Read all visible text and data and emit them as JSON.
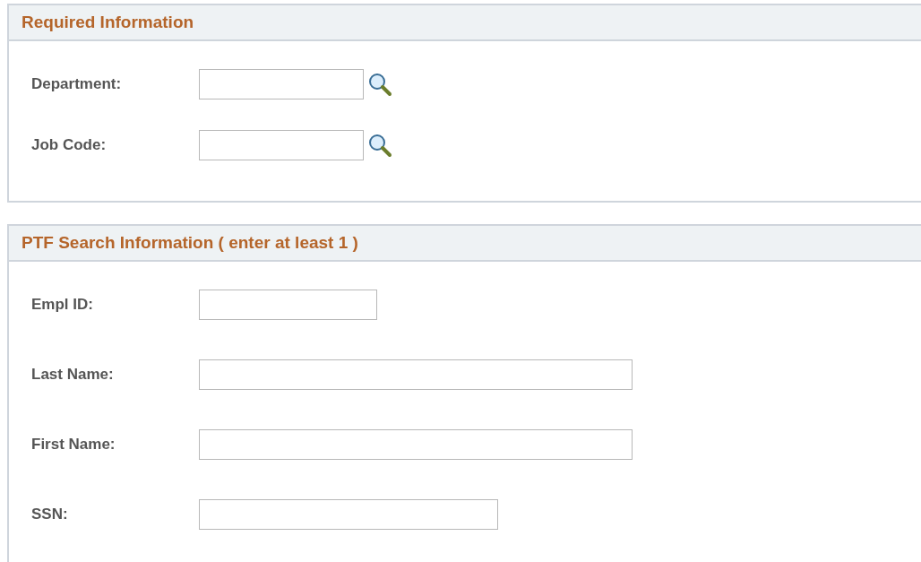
{
  "sections": [
    {
      "title": "Required Information",
      "closed": true,
      "fields": [
        {
          "label": "Department:",
          "lookup": true
        },
        {
          "label": "Job Code:",
          "lookup": true
        }
      ]
    },
    {
      "title": "PTF Search Information ( enter at least 1 )",
      "closed": false,
      "fields": [
        {
          "label": "Empl ID:",
          "lookup": false
        },
        {
          "label": "Last Name:",
          "lookup": false
        },
        {
          "label": "First Name:",
          "lookup": false
        },
        {
          "label": "SSN:",
          "lookup": false
        }
      ]
    }
  ]
}
